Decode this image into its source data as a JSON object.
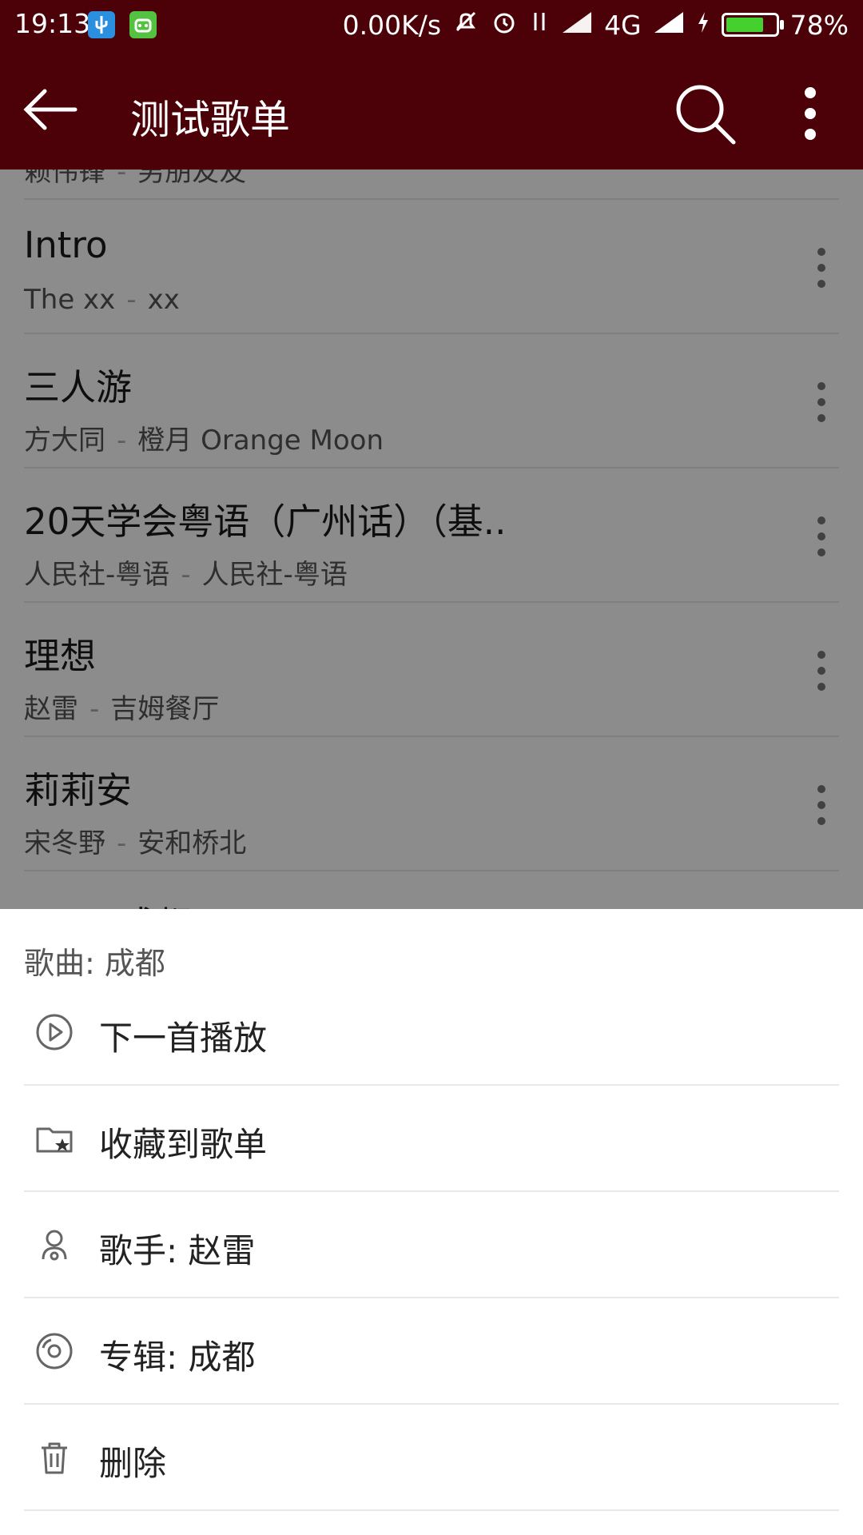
{
  "status_bar": {
    "time": "19:13",
    "net_speed": "0.00K/s",
    "network": "4G",
    "battery": "78%",
    "battery_level": 0.78,
    "colors": {
      "bar": "#4c0007",
      "battery_fill": "#44d12f"
    }
  },
  "app_bar": {
    "title": "测试歌单",
    "icons": {
      "back": "back-arrow-icon",
      "search": "search-icon",
      "more": "more-vert-icon"
    }
  },
  "list": {
    "partial_top": {
      "artist": "赖伟锋",
      "album": "男朋友友"
    },
    "items": [
      {
        "title": "Intro",
        "artist": "The xx",
        "album": "xx"
      },
      {
        "title": "三人游",
        "artist": "方大同",
        "album": "橙月 Orange Moon"
      },
      {
        "title": "20天学会粤语（广州话）（基..",
        "artist": "人民社-粤语",
        "album": "人民社-粤语"
      },
      {
        "title": "理想",
        "artist": "赵雷",
        "album": "吉姆餐厅"
      },
      {
        "title": "莉莉安",
        "artist": "宋冬野",
        "album": "安和桥北"
      }
    ],
    "partial_bottom": {
      "title": "成都"
    },
    "separator": "-"
  },
  "sheet": {
    "title": "歌曲: 成都",
    "actions": [
      {
        "label": "下一首播放",
        "icon": "play-next-icon"
      },
      {
        "label": "收藏到歌单",
        "icon": "folder-star-icon"
      },
      {
        "label": "歌手: 赵雷",
        "icon": "singer-icon"
      },
      {
        "label": "专辑: 成都",
        "icon": "album-disc-icon"
      },
      {
        "label": "删除",
        "icon": "trash-icon"
      }
    ]
  }
}
